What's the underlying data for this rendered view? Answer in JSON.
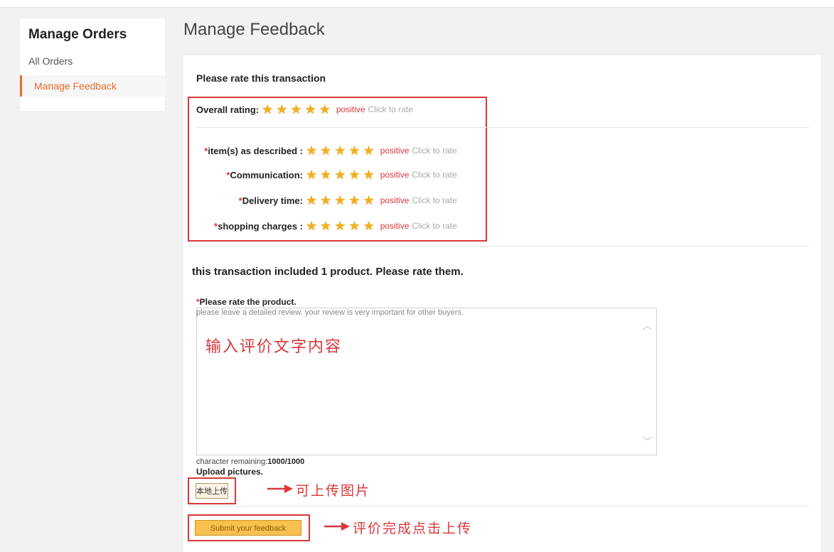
{
  "sidebar": {
    "title": "Manage Orders",
    "items": [
      {
        "label": "All Orders",
        "active": false
      },
      {
        "label": "Manage Feedback",
        "active": true
      }
    ]
  },
  "page_title": "Manage Feedback",
  "transaction": {
    "heading": "Please rate this transaction",
    "overall": {
      "label": "Overall rating:",
      "stars": 5,
      "status": "positive",
      "hint": "Click to rate"
    },
    "details": [
      {
        "label": "item(s) as described :",
        "required_mark": "*",
        "stars": 5,
        "status": "positive",
        "hint": "Click to rate"
      },
      {
        "label": "Communication:",
        "required_mark": "*",
        "stars": 5,
        "status": "positive",
        "hint": "Click to rate"
      },
      {
        "label": "Delivery time:",
        "required_mark": "*",
        "stars": 5,
        "status": "positive",
        "hint": "Click to rate"
      },
      {
        "label": "shopping charges :",
        "required_mark": "*",
        "stars": 5,
        "status": "positive",
        "hint": "Click to rate"
      }
    ]
  },
  "product": {
    "heading": "this transaction included 1 product. Please rate them.",
    "required_mark": "*",
    "rate_label": "Please rate the product.",
    "placeholder": "please leave a detailed review. your review is very important for other buyers.",
    "annotation": "输入评价文字内容",
    "char_remaining_label": "character remaining:",
    "char_remaining_value": "1000/1000",
    "upload_label": "Upload pictures.",
    "upload_button": "本地上传",
    "upload_annotation": "可上传图片",
    "submit_button": "Submit your feedback",
    "submit_annotation": "评价完成点击上传"
  },
  "colors": {
    "accent": "#d9373a",
    "active_nav": "#e56c2e",
    "star": "#f2b01e",
    "submit_bg": "#f8c04e"
  }
}
